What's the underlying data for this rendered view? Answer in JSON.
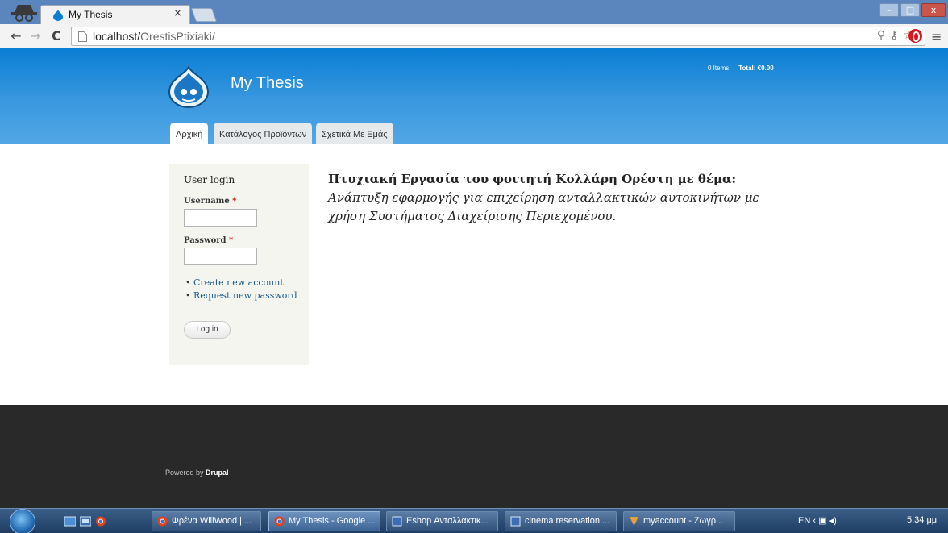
{
  "browser": {
    "tab_title": "My Thesis",
    "tab_close": "×",
    "url_host": "localhost/",
    "url_path": "OrestisPtixiaki/",
    "window_minimize": "–",
    "window_maximize": "□",
    "window_close": "x"
  },
  "site": {
    "name": "My Thesis",
    "cart_items": "0 Items",
    "cart_total": "Total: €0.00",
    "nav": [
      {
        "label": "Αρχική"
      },
      {
        "label": "Κατάλογος Προϊόντων"
      },
      {
        "label": "Σχετικά Με Εμάς"
      }
    ]
  },
  "login": {
    "title": "User login",
    "username_label": "Username",
    "password_label": "Password",
    "required_mark": "*",
    "username_value": "",
    "password_value": "",
    "links": [
      "Create new account",
      "Request new password"
    ],
    "submit": "Log in"
  },
  "content": {
    "bold_text": "Πτυχιακή Εργασία του φοιτητή Κολλάρη Ορέστη με θέμα:",
    "italic_text": "Ανάπτυξη εφαρμογής για επιχείρηση ανταλλακτικών αυτοκινήτων με χρήση Συστήματος Διαχείρισης Περιεχομένου."
  },
  "footer": {
    "powered_prefix": "Powered by",
    "powered_brand": "Drupal"
  },
  "taskbar": {
    "buttons": [
      {
        "label": "Φρένα WillWood | ..."
      },
      {
        "label": "My Thesis - Google ..."
      },
      {
        "label": "Eshop Ανταλλακτικ..."
      },
      {
        "label": "cinema reservation ..."
      },
      {
        "label": "myaccount - Ζωγρ..."
      }
    ],
    "language": "EN",
    "clock": "5:34 μμ"
  },
  "colors": {
    "header_top": "#0a7ed4",
    "header_bottom": "#53a7e6",
    "footer": "#292929",
    "link": "#1c5a8c"
  }
}
